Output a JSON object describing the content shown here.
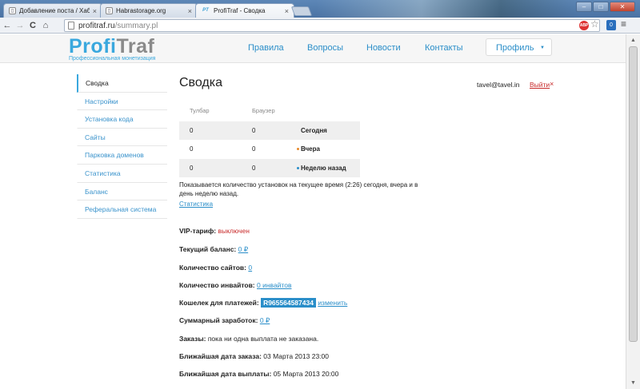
{
  "browser": {
    "tabs": [
      {
        "label": "Добавление поста / Хабра",
        "icon": "doc-favicon-icon"
      },
      {
        "label": "Habrastorage.org",
        "icon": "doc-favicon-icon"
      },
      {
        "label": "ProfiTraf - Сводка",
        "icon": "pt-favicon-icon",
        "favicon_text": "PT"
      }
    ],
    "tab_close": "×",
    "window_buttons": {
      "minimize": "–",
      "maximize": "□",
      "close": "✕"
    },
    "nav": {
      "back": "←",
      "forward": "→",
      "reload": "C",
      "home": "⌂"
    },
    "url_host": "profitraf.ru",
    "url_path": "/summary.pl",
    "adblock_label": "ABP",
    "star": "☆",
    "ext_badge": "0",
    "menu": "≡"
  },
  "site": {
    "logo_part1": "Profi",
    "logo_part2": "Traf",
    "tagline": "Профессиональная монетизация",
    "nav": [
      "Правила",
      "Вопросы",
      "Новости",
      "Контакты"
    ],
    "profile_label": "Профиль",
    "profile_caret": "▼"
  },
  "sidebar": {
    "items": [
      {
        "label": "Сводка",
        "active": true
      },
      {
        "label": "Настройки"
      },
      {
        "label": "Установка кода"
      },
      {
        "label": "Сайты"
      },
      {
        "label": "Парковка доменов"
      },
      {
        "label": "Статистика"
      },
      {
        "label": "Баланс"
      },
      {
        "label": "Реферальная система"
      }
    ]
  },
  "main": {
    "title": "Сводка",
    "user_email": "tavel@tavel.in",
    "logout_label": "Выйти",
    "logout_x": "×",
    "stats": {
      "headers": [
        "Тулбар",
        "Браузер"
      ],
      "rows": [
        {
          "toolbar": "0",
          "browser": "0",
          "period": "Сегодня",
          "marker": null
        },
        {
          "toolbar": "0",
          "browser": "0",
          "period": "Вчера",
          "marker": "#e8892a"
        },
        {
          "toolbar": "0",
          "browser": "0",
          "period": "Неделю назад",
          "marker": "#2a8ec9"
        }
      ]
    },
    "note": "Показывается количество установок на текущее время (2:26) сегодня, вчера и в день неделю назад.",
    "stats_link": "Статистика",
    "fields": {
      "vip_label": "VIP-тариф:",
      "vip_value": "выключен",
      "balance_label": "Текущий баланс:",
      "balance_value": "0 ₽",
      "sites_label": "Количество сайтов:",
      "sites_value": "0",
      "invites_label": "Количество инвайтов:",
      "invites_value": "0 инвайтов",
      "wallet_label": "Кошелек для платежей:",
      "wallet_value": "R965564587434",
      "wallet_change": "изменить",
      "earned_label": "Суммарный заработок:",
      "earned_value": "0 ₽",
      "orders_label": "Заказы:",
      "orders_value": "пока ни одна выплата не заказана.",
      "next_order_label": "Ближайшая дата заказа:",
      "next_order_value": "03 Марта 2013 23:00",
      "next_payout_label": "Ближайшая дата выплаты:",
      "next_payout_value": "05 Марта 2013 20:00"
    }
  },
  "colors": {
    "accent": "#3aa8de",
    "link": "#2a8ec9",
    "danger": "#c82a2a",
    "yesterday": "#e8892a",
    "week": "#2a8ec9"
  }
}
